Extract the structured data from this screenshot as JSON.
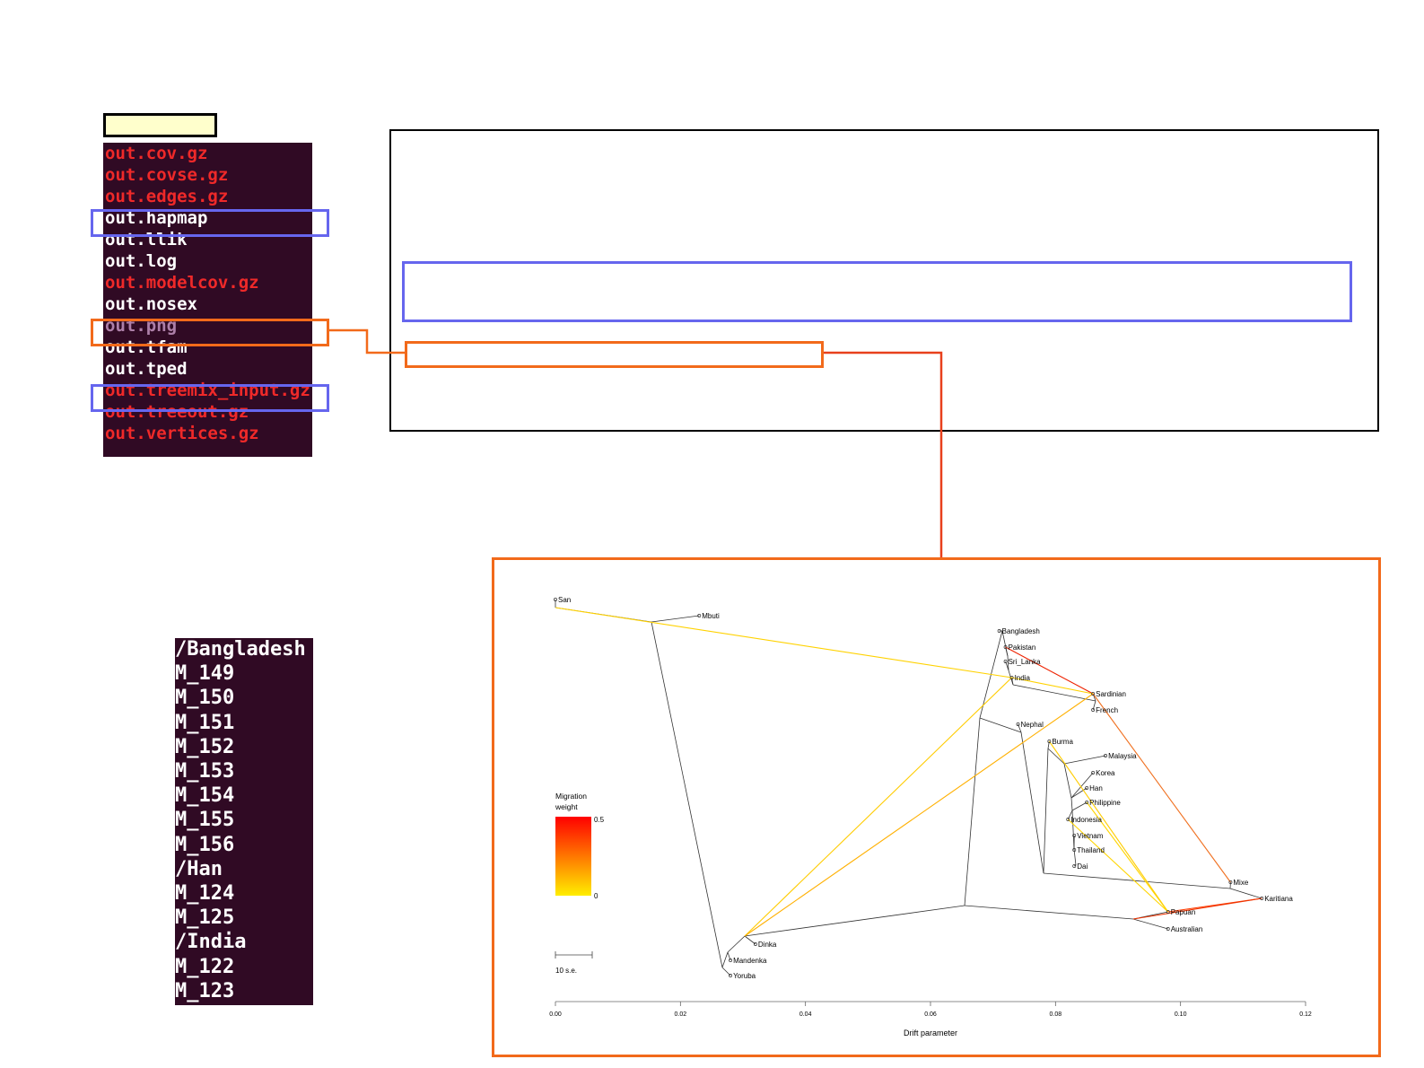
{
  "file_listing": {
    "items": [
      {
        "name": "out.cov.gz",
        "color": "#ef2929"
      },
      {
        "name": "out.covse.gz",
        "color": "#ef2929"
      },
      {
        "name": "out.edges.gz",
        "color": "#ef2929"
      },
      {
        "name": "out.hapmap",
        "color": "#ffffff"
      },
      {
        "name": "out.llik",
        "color": "#ffffff"
      },
      {
        "name": "out.log",
        "color": "#ffffff"
      },
      {
        "name": "out.modelcov.gz",
        "color": "#ef2929"
      },
      {
        "name": "out.nosex",
        "color": "#ffffff"
      },
      {
        "name": "out.png",
        "color": "#ad7fa8"
      },
      {
        "name": "out.tfam",
        "color": "#ffffff"
      },
      {
        "name": "out.tped",
        "color": "#ffffff"
      },
      {
        "name": "out.treemix_input.gz",
        "color": "#ef2929"
      },
      {
        "name": "out.treeout.gz",
        "color": "#ef2929"
      },
      {
        "name": "out.vertices.gz",
        "color": "#ef2929"
      }
    ]
  },
  "population_listing": {
    "lines": [
      "/Bangladesh",
      "M_149",
      "M_150",
      "M_151",
      "M_152",
      "M_153",
      "M_154",
      "M_155",
      "M_156",
      "/Han",
      "M_124",
      "M_125",
      "/India",
      "M_122",
      "M_123"
    ]
  },
  "colors": {
    "terminal_bg": "#300a24",
    "highlight_blue": "#6666ee",
    "highlight_orange": "#f26a1b",
    "label_fill": "#ffffcc"
  },
  "chart_data": {
    "type": "tree",
    "xlabel": "Drift parameter",
    "xlim": [
      0.0,
      0.12
    ],
    "x_ticks": [
      "0.00",
      "0.02",
      "0.04",
      "0.06",
      "0.08",
      "0.10",
      "0.12"
    ],
    "legend": {
      "title_line1": "Migration",
      "title_line2": "weight",
      "max_label": "0.5",
      "min_label": "0",
      "placement": "left",
      "scale_bar_label": "10 s.e."
    },
    "leaves": [
      {
        "name": "San",
        "drift": 0.0
      },
      {
        "name": "Mbuti",
        "drift": 0.023
      },
      {
        "name": "Bangladesh",
        "drift": 0.071
      },
      {
        "name": "Pakistan",
        "drift": 0.072
      },
      {
        "name": "Sri_Lanka",
        "drift": 0.072
      },
      {
        "name": "India",
        "drift": 0.073
      },
      {
        "name": "Sardinian",
        "drift": 0.086
      },
      {
        "name": "French",
        "drift": 0.086
      },
      {
        "name": "Nephal",
        "drift": 0.074
      },
      {
        "name": "Burma",
        "drift": 0.079
      },
      {
        "name": "Malaysia",
        "drift": 0.088
      },
      {
        "name": "Korea",
        "drift": 0.086
      },
      {
        "name": "Han",
        "drift": 0.085
      },
      {
        "name": "Philippine",
        "drift": 0.085
      },
      {
        "name": "Indonesia",
        "drift": 0.082
      },
      {
        "name": "Vietnam",
        "drift": 0.083
      },
      {
        "name": "Thailand",
        "drift": 0.083
      },
      {
        "name": "Dai",
        "drift": 0.083
      },
      {
        "name": "Mixe",
        "drift": 0.108
      },
      {
        "name": "Karitiana",
        "drift": 0.113
      },
      {
        "name": "Papuan",
        "drift": 0.098
      },
      {
        "name": "Australian",
        "drift": 0.098
      },
      {
        "name": "Dinka",
        "drift": 0.032
      },
      {
        "name": "Mandenka",
        "drift": 0.028
      },
      {
        "name": "Yoruba",
        "drift": 0.028
      }
    ]
  }
}
